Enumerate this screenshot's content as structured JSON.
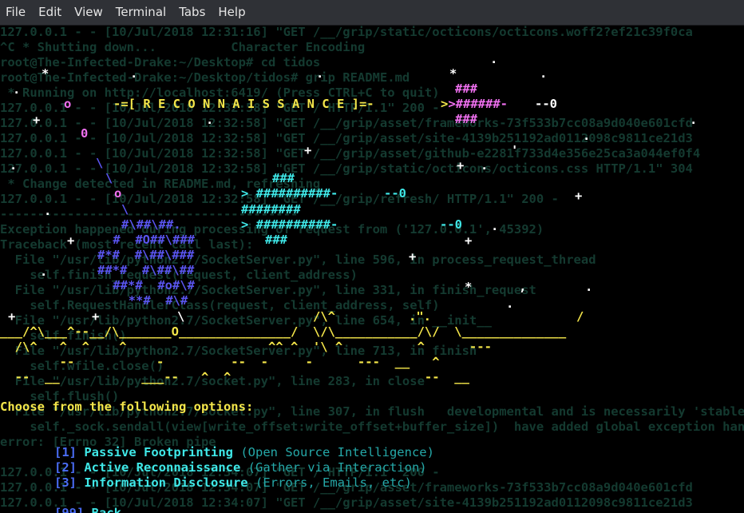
{
  "menubar": {
    "items": [
      "File",
      "Edit",
      "View",
      "Terminal",
      "Tabs",
      "Help"
    ]
  },
  "background_lines": [
    "127.0.0.1 - - [10/Jul/2018 12:31:16] \"GET /__/grip/static/octicons/octicons.woff2?ef21c39f0ca",
    "^C * Shutting down...          Character Encoding",
    "root@The-Infected-Drake:~/Desktop# cd tidos",
    "root@The-Infected-Drake:~/Desktop/tidos# grip README.md",
    " * Running on http://localhost:6419/ (Press CTRL+C to quit)",
    "127.0.0.1 - - [10/Jul/2018 12:32:58] \"GET / HTTP/1.1\" 200 -",
    "127.0.0.1 - - [10/Jul/2018 12:32:58] \"GET /__/grip/asset/frameworks-73f533b7cc08a9d040e601cfd",
    "127.0.0.1 - - [10/Jul/2018 12:32:58] \"GET /__/grip/asset/site-4139b251192ad0112098c9811ce21d3",
    "127.0.0.1 - - [10/Jul/2018 12:32:58] \"GET /__/grip/asset/github-e2281f733d4e356e25ca3a044ef0f4",
    "127.0.0.1 - - [10/Jul/2018 12:32:58] \"GET /__/grip/static/octicons/octicons.css HTTP/1.1\" 304",
    " * Change detected in README.md, refreshing",
    "127.0.0.1 - - [10/Jul/2018 12:32:58] \"GET /__/grip/refresh/ HTTP/1.1\" 200 -",
    "----------------------------------------",
    "Exception happened during processing of request from ('127.0.0.1', 45392)",
    "Traceback (most recent call last):",
    "  File \"/usr/lib/python2.7/SocketServer.py\", line 596, in process_request_thread",
    "    self.finish_request(request, client_address)",
    "  File \"/usr/lib/python2.7/SocketServer.py\", line 331, in finish_request",
    "    self.RequestHandlerClass(request, client_address, self)",
    "  File \"/usr/lib/python2.7/SocketServer.py\", line 654, in __init__",
    "    self.finish()",
    "  File \"/usr/lib/python2.7/SocketServer.py\", line 713, in finish",
    "    self.wfile.close()",
    "  File \"/usr/lib/python2.7/socket.py\", line 283, in close",
    "    self.flush()",
    "  File \"/usr/lib/python2.7/socket.py\", line 307, in flush   developmental and is necessarily 'stable'. There are bugs in resolving",
    "    self._sock.sendall(view[write_offset:write_offset+buffer_size])  have added global exception handling, still, there maybe bugs",
    "error: [Errno 32] Broken pipe",
    "",
    "127.0.0.1 - - [10/Jul/2018 12:34:07] \"GET / HTTP/1.1\" 200 -",
    "127.0.0.1 - - [10/Jul/2018 12:34:07] \"GET /__/grip/asset/frameworks-73f533b7cc08a9d040e601cfd",
    "127.0.0.1 - - [10/Jul/2018 12:34:07] \"GET /__/grip/asset/site-4139b251192ad0112098c9811ce21d3"
  ],
  "banner": {
    "title_text": "-=[ R E C O N N A I S S A N C E ]=-",
    "arrow_top": ">######-",
    "arrow_top_tail": "--0",
    "arrow_mid1": "> ##########-",
    "arrow_mid1_tail": "--0",
    "arrow_mid2": "> ##########-",
    "arrow_mid2_tail": "--0",
    "ship_top": "###",
    "ship_top2": "###",
    "ship_mid_top": "###",
    "ship_mid_block": "########",
    "ship_mid_bottom": "###",
    "moon": [
      "#\\##\\##.",
      " #  #O##\\###",
      "#*#  #\\##\\###",
      "##*#  #\\##\\##",
      " ##*#  #o#\\#",
      "  **#  #\\#"
    ],
    "mountains": [
      "___/^\\___^--__/\\_______O_______________/  \\/\\___________/\\/  \\______________",
      "  /\\^   ^  ^    ^                   ^^ ^  '\\ ^          ^      ---",
      "        --           -         --  -     -      ---  __   ^",
      "  --  __           ___--   ^  ^                          --  __"
    ]
  },
  "prompt": {
    "heading": "Choose from the following options:"
  },
  "options": [
    {
      "num": "[1]",
      "label": "Passive Footprinting",
      "desc": "(Open Source Intelligence)"
    },
    {
      "num": "[2]",
      "label": "Active Reconnaissance",
      "desc": "(Gather via Interaction)"
    },
    {
      "num": "[3]",
      "label": "Information Disclosure",
      "desc": "(Errors, Emails, etc)"
    },
    {
      "num": "[99]",
      "label": "Back",
      "desc": ""
    }
  ]
}
